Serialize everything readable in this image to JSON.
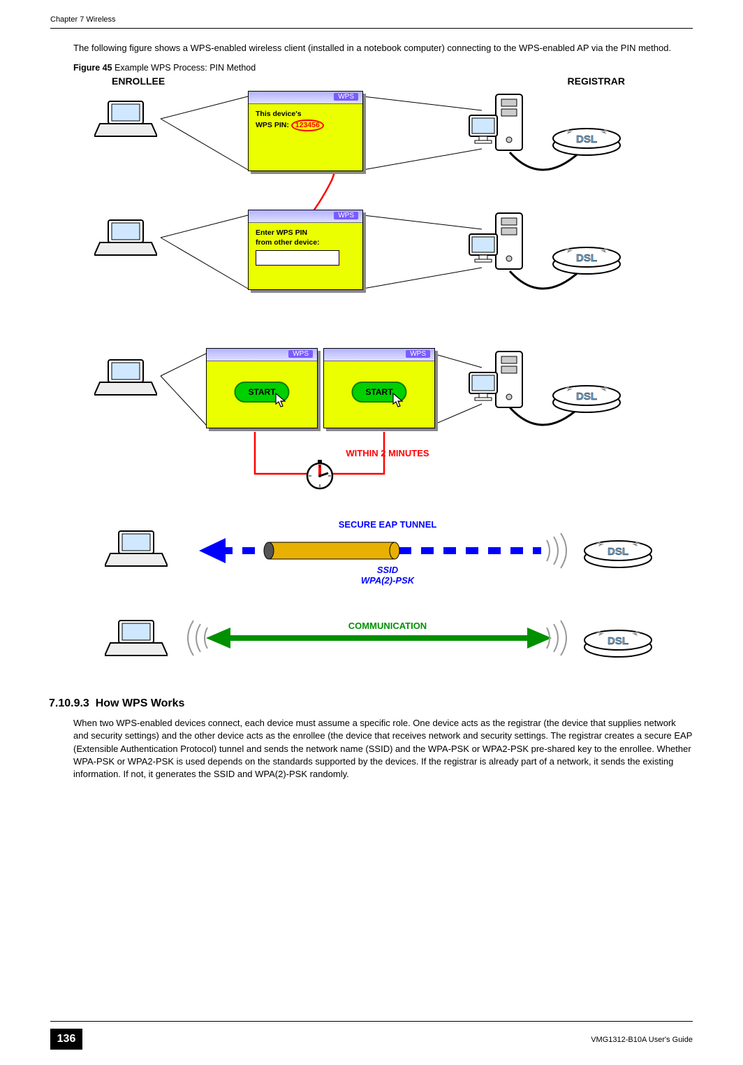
{
  "header": {
    "chapter": "Chapter 7 Wireless"
  },
  "intro_para": "The following figure shows a WPS-enabled wireless client (installed in a notebook computer) connecting to the WPS-enabled AP via the PIN method.",
  "figure": {
    "caption_bold": "Figure 45",
    "caption_rest": "   Example WPS Process: PIN Method",
    "enrollee_label": "ENROLLEE",
    "registrar_label": "REGISTRAR",
    "wps_tab": "WPS",
    "device_pin_line1": "This device's",
    "device_pin_line2_prefix": "WPS PIN: ",
    "device_pin_value": "123456",
    "enter_pin_line1": "Enter WPS PIN",
    "enter_pin_line2": "from other device:",
    "start_label": "START",
    "within2": "WITHIN 2 MINUTES",
    "eap_tunnel": "SECURE EAP TUNNEL",
    "ssid_block": "SSID\nWPA(2)-PSK",
    "communication": "COMMUNICATION",
    "dsl_text": "DSL"
  },
  "section": {
    "number": "7.10.9.3",
    "title": "How WPS Works",
    "body": "When two WPS-enabled devices connect, each device must assume a specific role. One device acts as the registrar (the device that supplies network and security settings) and the other device acts as the enrollee (the device that receives network and security settings. The registrar creates a secure EAP (Extensible Authentication Protocol) tunnel and sends the network name (SSID) and the WPA-PSK or WPA2-PSK pre-shared key to the enrollee. Whether WPA-PSK or WPA2-PSK is used depends on the standards supported by the devices. If the registrar is already part of a network, it sends the existing information. If not, it generates the SSID and WPA(2)-PSK randomly."
  },
  "footer": {
    "page": "136",
    "guide": "VMG1312-B10A User's Guide"
  }
}
